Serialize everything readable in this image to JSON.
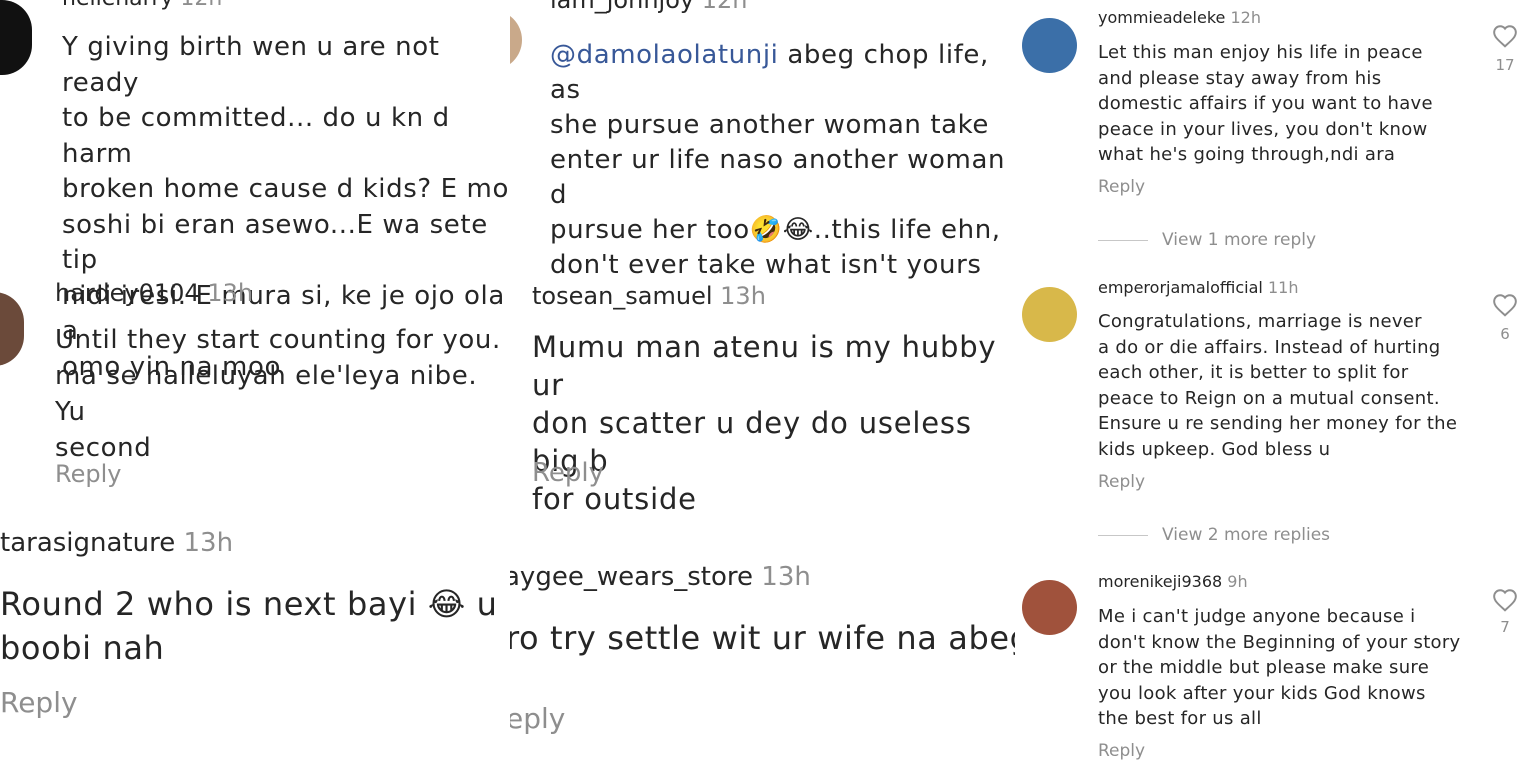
{
  "comments": [
    {
      "username": "hellenarry",
      "time": "12h",
      "text": "Y giving birth wen u are not ready\nto be committed... do u kn d harm\nbroken home cause d kids? E mo\nsoshi bi eran asewo...E wa sete tip\nnidi iresi. E mura si, ke je ojo ola a\nomo yin na moo"
    },
    {
      "username": "iam_johnjoy",
      "time": "12h",
      "mention": "@damolaolatunji",
      "text": " abeg chop life, as\nshe pursue another woman take\nenter ur life naso another woman d\npursue her too🤣😂..this life ehn,\ndon't ever take what isn't yours"
    },
    {
      "username": "hardey0104",
      "time": "13h",
      "text": "Until they start counting for you.\nma se halleluyah ele'leya nibe. Yu\nsecond",
      "reply": "Reply"
    },
    {
      "username": "tosean_samuel",
      "time": "13h",
      "text": "Mumu man atenu is my hubby ur\ndon scatter u dey do useless big b\nfor outside",
      "reply": "Reply"
    },
    {
      "username": "tarasignature",
      "time": "13h",
      "text": "Round 2 who is next bayi 😂 u\nboobi nah",
      "reply": "Reply"
    },
    {
      "username": "aygee_wears_store",
      "time": "13h",
      "text": "ro try settle wit ur wife na abeg",
      "reply": "eply"
    },
    {
      "username": "yommieadeleke",
      "time": "12h",
      "text": "Let this man enjoy his life in peace\nand please  stay away from his\ndomestic affairs if you want to have\npeace in your lives, you don't know\nwhat he's going through,ndi ara",
      "reply": "Reply",
      "likes": "17",
      "view_more": "View 1 more reply"
    },
    {
      "username": "emperorjamalofficial",
      "time": "11h",
      "text": "Congratulations,  marriage is never\na do or die affairs. Instead of hurting\neach other, it is better to split for\npeace to Reign on a mutual consent.\nEnsure u re sending her money for the\nkids upkeep. God bless u",
      "reply": "Reply",
      "likes": "6",
      "view_more": "View 2 more replies"
    },
    {
      "username": "morenikeji9368",
      "time": "9h",
      "text": "Me i can't judge anyone because i\ndon't know the Beginning of your story\nor the middle but please make sure\nyou look after your kids God knows\nthe best for us all",
      "reply": "Reply",
      "likes": "7"
    }
  ],
  "colors": {
    "text": "#262626",
    "muted": "#8e8e8e",
    "mention": "#385898"
  },
  "icons": {
    "like": "heart-outline-icon"
  }
}
